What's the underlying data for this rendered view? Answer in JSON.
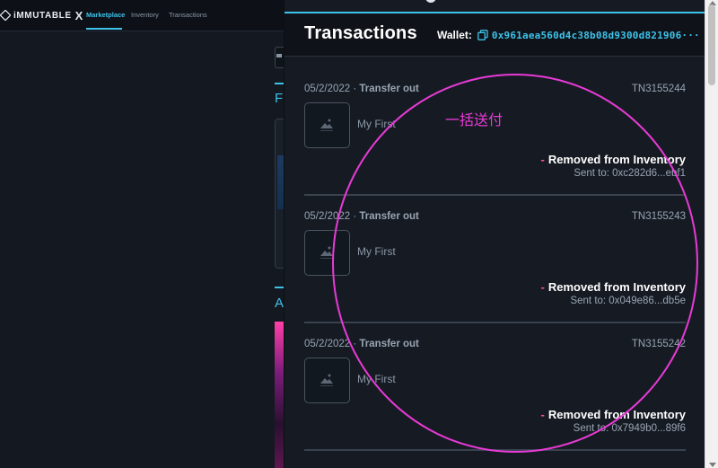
{
  "topnav": {
    "brand": "iMMUTABLE",
    "brand_x": "X",
    "links": [
      "Marketplace",
      "Inventory",
      "Transactions"
    ],
    "active_color": "#3ec2e9"
  },
  "background": {
    "heading_1": "F",
    "heading_2": "A"
  },
  "panel": {
    "title": "Transactions",
    "wallet_label": "Wallet:",
    "wallet_address": "0x961aea560d4c38b08d9300d821906···",
    "accent_color": "#3ec2e9"
  },
  "transactions": [
    {
      "date": "05/2/2022",
      "type": "Transfer out",
      "id": "TN3155244",
      "name": "My First",
      "status": "Removed from Inventory",
      "sent_to": "Sent to: 0xc282d6...ebf1"
    },
    {
      "date": "05/2/2022",
      "type": "Transfer out",
      "id": "TN3155243",
      "name": "My First",
      "status": "Removed from Inventory",
      "sent_to": "Sent to: 0x049e86...db5e"
    },
    {
      "date": "05/2/2022",
      "type": "Transfer out",
      "id": "TN3155242",
      "name": "My First",
      "status": "Removed from Inventory",
      "sent_to": "Sent to: 0x7949b0...89f6"
    }
  ],
  "annotation": {
    "text": "一括送付",
    "color": "#e83ad6"
  }
}
